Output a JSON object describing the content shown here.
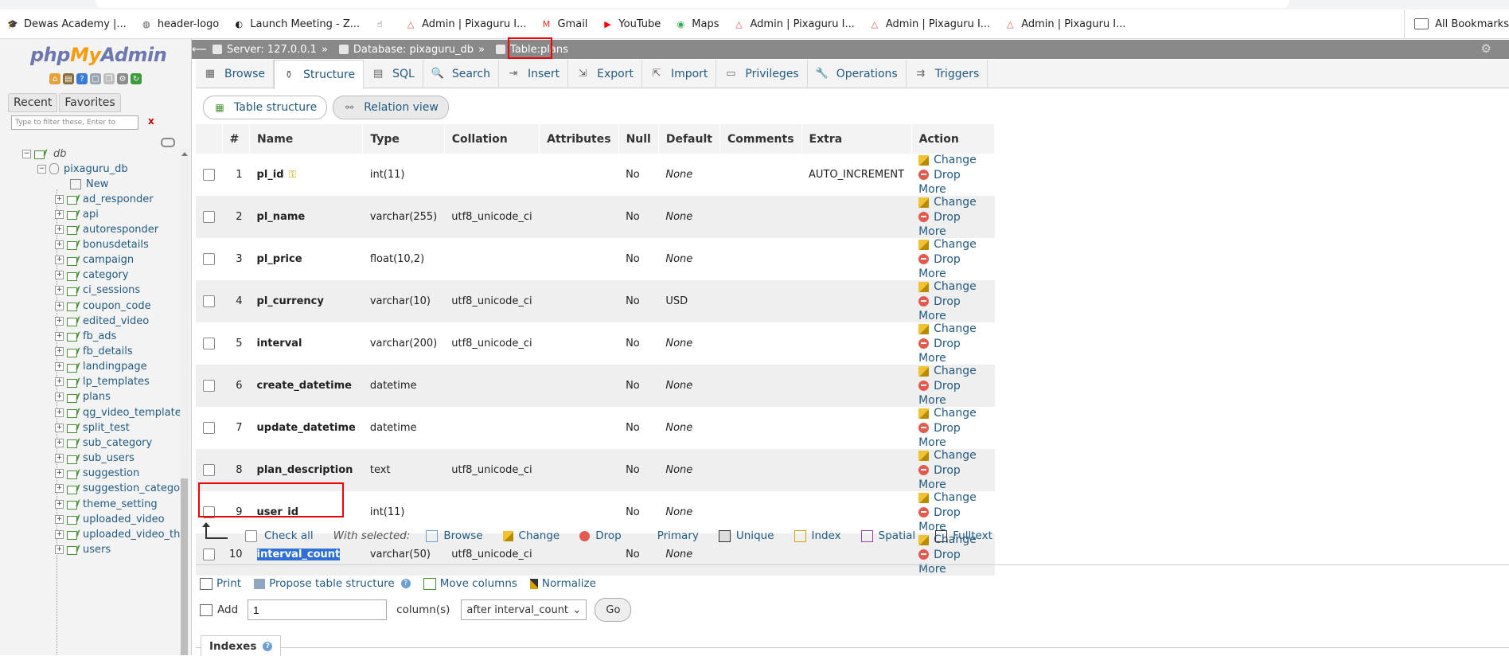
{
  "bookmarks": [
    {
      "label": "Dewas Academy |...",
      "icon": "graduation-icon",
      "color": "#c0392b"
    },
    {
      "label": "header-logo",
      "icon": "logo-icon",
      "color": "#555"
    },
    {
      "label": "Launch Meeting - Z...",
      "icon": "globe-icon",
      "color": "#222"
    },
    {
      "label": "",
      "icon": "hand-icon",
      "color": "#333"
    },
    {
      "label": "Admin | Pixaguru I...",
      "icon": "pixaguru-icon",
      "color": "#d9534f"
    },
    {
      "label": "Gmail",
      "icon": "gmail-icon",
      "color": "#d93025"
    },
    {
      "label": "YouTube",
      "icon": "youtube-icon",
      "color": "#ff0000"
    },
    {
      "label": "Maps",
      "icon": "maps-icon",
      "color": "#34a853"
    },
    {
      "label": "Admin | Pixaguru I...",
      "icon": "pixaguru-icon",
      "color": "#d9534f"
    },
    {
      "label": "Admin | Pixaguru I...",
      "icon": "pixaguru-icon",
      "color": "#d9534f"
    },
    {
      "label": "Admin | Pixaguru I...",
      "icon": "pixaguru-icon",
      "color": "#d9534f"
    }
  ],
  "all_bookmarks": "All Bookmarks",
  "logo": {
    "php": "php",
    "my": "My",
    "admin": "Admin"
  },
  "left_tabs": {
    "recent": "Recent",
    "favorites": "Favorites"
  },
  "filter": {
    "placeholder": "Type to filter these, Enter to search all",
    "clear": "x"
  },
  "tree": {
    "db": "db",
    "database": "pixaguru_db",
    "new": "New",
    "tables": [
      "ad_responder",
      "api",
      "autoresponder",
      "bonusdetails",
      "campaign",
      "category",
      "ci_sessions",
      "coupon_code",
      "edited_video",
      "fb_ads",
      "fb_details",
      "landingpage",
      "lp_templates",
      "plans",
      "qg_video_templates",
      "split_test",
      "sub_category",
      "sub_users",
      "suggestion",
      "suggestion_category",
      "theme_setting",
      "uploaded_video",
      "uploaded_video_thumb",
      "users"
    ]
  },
  "breadcrumb": {
    "server": "Server: 127.0.0.1",
    "database": "Database: pixaguru_db",
    "table_prefix": "Table: ",
    "table": "plans"
  },
  "tabs": [
    "Browse",
    "Structure",
    "SQL",
    "Search",
    "Insert",
    "Export",
    "Import",
    "Privileges",
    "Operations",
    "Triggers"
  ],
  "subtabs": {
    "structure": "Table structure",
    "relation": "Relation view"
  },
  "columns": [
    "#",
    "Name",
    "Type",
    "Collation",
    "Attributes",
    "Null",
    "Default",
    "Comments",
    "Extra",
    "Action"
  ],
  "rows": [
    {
      "num": "1",
      "name": "pl_id",
      "type": "int(11)",
      "collation": "",
      "null": "No",
      "default": "None",
      "extra": "AUTO_INCREMENT",
      "key": true
    },
    {
      "num": "2",
      "name": "pl_name",
      "type": "varchar(255)",
      "collation": "utf8_unicode_ci",
      "null": "No",
      "default": "None",
      "extra": ""
    },
    {
      "num": "3",
      "name": "pl_price",
      "type": "float(10,2)",
      "collation": "",
      "null": "No",
      "default": "None",
      "extra": ""
    },
    {
      "num": "4",
      "name": "pl_currency",
      "type": "varchar(10)",
      "collation": "utf8_unicode_ci",
      "null": "No",
      "default": "USD",
      "extra": ""
    },
    {
      "num": "5",
      "name": "interval",
      "type": "varchar(200)",
      "collation": "utf8_unicode_ci",
      "null": "No",
      "default": "None",
      "extra": ""
    },
    {
      "num": "6",
      "name": "create_datetime",
      "type": "datetime",
      "collation": "",
      "null": "No",
      "default": "None",
      "extra": ""
    },
    {
      "num": "7",
      "name": "update_datetime",
      "type": "datetime",
      "collation": "",
      "null": "No",
      "default": "None",
      "extra": ""
    },
    {
      "num": "8",
      "name": "plan_description",
      "type": "text",
      "collation": "utf8_unicode_ci",
      "null": "No",
      "default": "None",
      "extra": ""
    },
    {
      "num": "9",
      "name": "user_id",
      "type": "int(11)",
      "collation": "",
      "null": "No",
      "default": "None",
      "extra": ""
    },
    {
      "num": "10",
      "name": "interval_count",
      "type": "varchar(50)",
      "collation": "utf8_unicode_ci",
      "null": "No",
      "default": "None",
      "extra": "",
      "selected": true
    }
  ],
  "row_actions": {
    "change": "Change",
    "drop": "Drop",
    "more": "More"
  },
  "bulk": {
    "check_all": "Check all",
    "with_selected": "With selected:",
    "actions": [
      "Browse",
      "Change",
      "Drop",
      "Primary",
      "Unique",
      "Index",
      "Spatial",
      "Fulltext"
    ]
  },
  "bottom_links": {
    "print": "Print",
    "propose": "Propose table structure",
    "move": "Move columns",
    "normalize": "Normalize"
  },
  "add": {
    "label": "Add",
    "value": "1",
    "columns": "column(s)",
    "position": "after interval_count",
    "go": "Go"
  },
  "indexes": "Indexes"
}
